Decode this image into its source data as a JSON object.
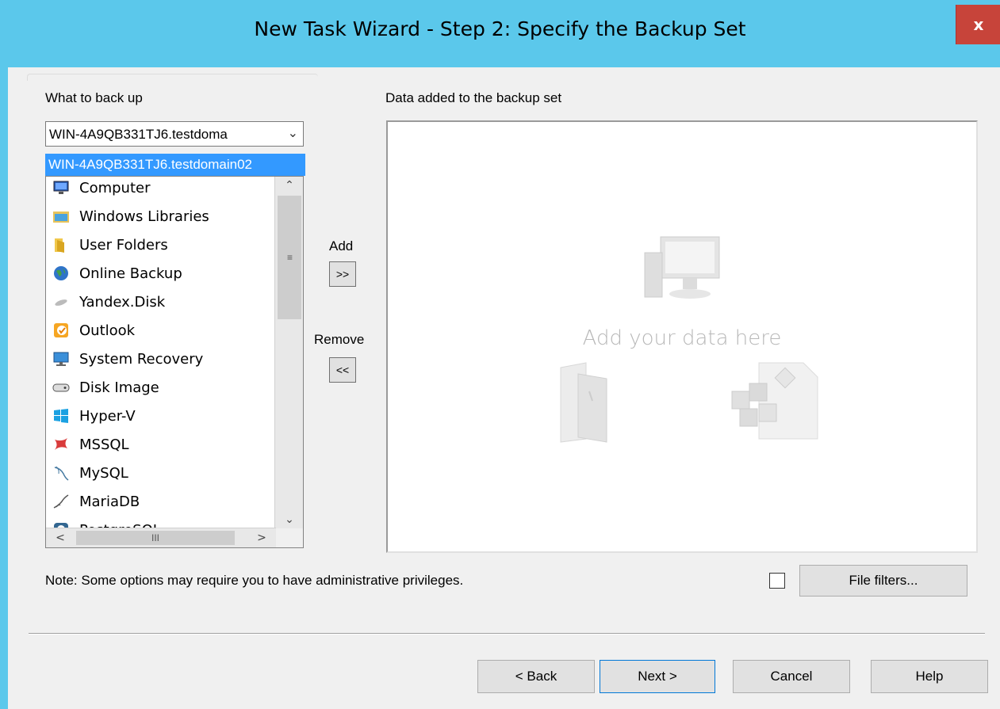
{
  "window": {
    "title": "New Task Wizard - Step 2: Specify the Backup Set",
    "close_label": "x"
  },
  "source": {
    "label": "What to back up",
    "selected": "WIN-4A9QB331TJ6.testdoma",
    "dropdown_option": "WIN-4A9QB331TJ6.testdomain02",
    "items": [
      {
        "label": "Computer",
        "icon": "computer-icon"
      },
      {
        "label": "Windows Libraries",
        "icon": "libraries-icon"
      },
      {
        "label": "User Folders",
        "icon": "folder-icon"
      },
      {
        "label": "Online Backup",
        "icon": "globe-icon"
      },
      {
        "label": "Yandex.Disk",
        "icon": "cloud-icon"
      },
      {
        "label": "Outlook",
        "icon": "outlook-icon"
      },
      {
        "label": "System Recovery",
        "icon": "monitor-icon"
      },
      {
        "label": "Disk Image",
        "icon": "disk-icon"
      },
      {
        "label": "Hyper-V",
        "icon": "windows-icon"
      },
      {
        "label": "MSSQL",
        "icon": "mssql-icon"
      },
      {
        "label": "MySQL",
        "icon": "dolphin-icon"
      },
      {
        "label": "MariaDB",
        "icon": "seal-icon"
      },
      {
        "label": "PostgreSQL",
        "icon": "elephant-icon"
      }
    ],
    "hscroll_grip": "III"
  },
  "transfer": {
    "add_label": "Add",
    "add_button": ">>",
    "remove_label": "Remove",
    "remove_button": "<<"
  },
  "target": {
    "label": "Data added to the backup set",
    "placeholder": "Add your data here"
  },
  "note": "Note: Some options may require you to have administrative privileges.",
  "file_filters": {
    "label": "File filters...",
    "checked": false
  },
  "footer": {
    "back": "< Back",
    "next": "Next >",
    "cancel": "Cancel",
    "help": "Help"
  },
  "colors": {
    "titlebar": "#5bc8eb",
    "selection": "#3399ff",
    "close": "#c7443a"
  }
}
